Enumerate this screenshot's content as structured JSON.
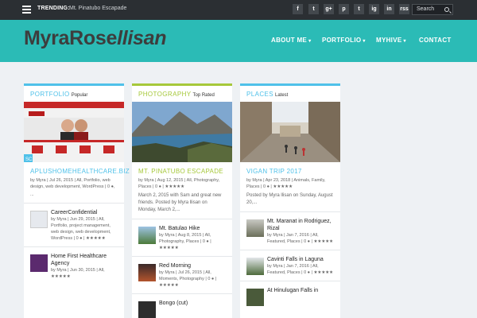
{
  "topbar": {
    "trending_label": "TRENDING:",
    "trending_link": "Mt. Pinatubo Escapade",
    "social": [
      "f",
      "t",
      "g+",
      "p",
      "t",
      "ig",
      "in",
      "rss"
    ],
    "search_placeholder": "Search"
  },
  "header": {
    "logo_main": "MyraRose",
    "logo_ital": "llisan",
    "nav": [
      {
        "label": "ABOUT ME",
        "has_sub": true
      },
      {
        "label": "PORTFOLIO",
        "has_sub": true
      },
      {
        "label": "MYHIVE",
        "has_sub": true
      },
      {
        "label": "CONTACT",
        "has_sub": false
      }
    ]
  },
  "colors": {
    "portfolio": "#4fc1e9",
    "photography": "#a6c83a",
    "places": "#4fc1e9",
    "header_bg": "#2bbbb6"
  },
  "columns": {
    "portfolio": {
      "heading": "PORTFOLIO",
      "sub": "Popular",
      "feature_title": "APLUSHOMEHEALTHCARE.BIZ",
      "feature_meta": "by Myra | Jul 26, 2015 | All, Portfolio, web design, web development, WordPress | 0 ●,",
      "feature_more": "...",
      "items": [
        {
          "title": "CareerConfidential",
          "meta": "by Myra | Jun 29, 2015 | All, Portfolio, project management, web design, web development, WordPress | 0 ● | ★★★★★"
        },
        {
          "title": "Home First Healthcare Agency",
          "meta": "by Myra | Jun 30, 2015 | All, ★★★★★"
        }
      ]
    },
    "photography": {
      "heading": "PHOTOGRAPHY",
      "sub": "Top Rated",
      "feature_title": "MT. PINATUBO ESCAPADE",
      "feature_meta": "by Myra | Aug 12, 2015 | All, Photography, Places | 0 ● | ★★★★★",
      "feature_excerpt": "March 2, 2015 with Sam and great new friends. Posted by Myra llisan on Monday, March 2,...",
      "items": [
        {
          "title": "Mt. Batulao Hike",
          "meta": "by Myra | Aug 8, 2015 | All, Photography, Places | 0 ● | ★★★★★"
        },
        {
          "title": "Red Morning",
          "meta": "by Myra | Jul 26, 2015 | All, Moments, Photography | 0 ● | ★★★★★"
        },
        {
          "title": "Bongo (cut)",
          "meta": ""
        }
      ]
    },
    "places": {
      "heading": "PLACES",
      "sub": "Latest",
      "feature_title": "VIGAN TRIP 2017",
      "feature_meta": "by Myra | Apr 23, 2018 | Animals, Family, Places | 0 ● | ★★★★★",
      "feature_excerpt": "Posted by Myra llisan on Sunday, August 20,...",
      "items": [
        {
          "title": "Mt. Maranat in Rodriguez, Rizal",
          "meta": "by Myra | Jan 7, 2016 | All, Featured, Places | 0 ● | ★★★★★"
        },
        {
          "title": "Cavinti Falls in Laguna",
          "meta": "by Myra | Jan 7, 2016 | All, Featured, Places | 0 ● | ★★★★★"
        },
        {
          "title": "At Hinulugan Falls in",
          "meta": ""
        }
      ]
    }
  }
}
